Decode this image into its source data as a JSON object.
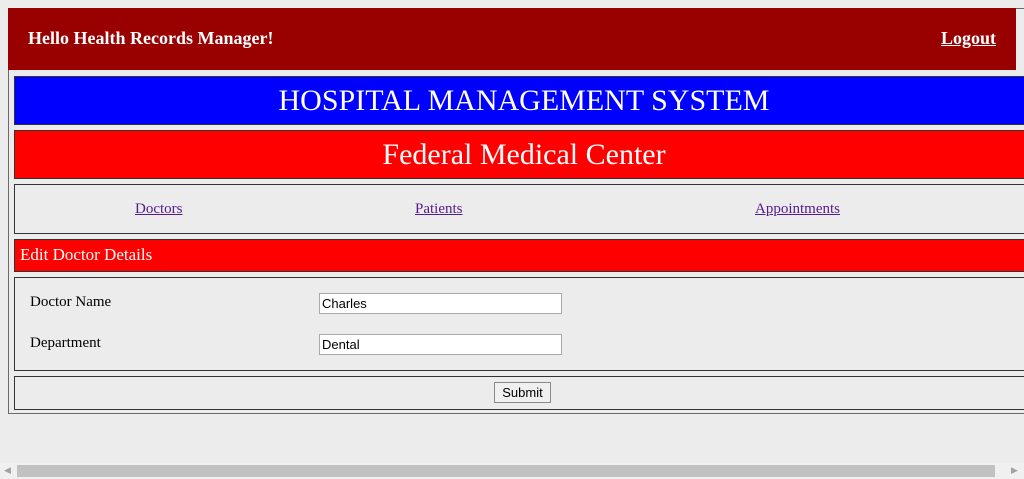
{
  "header": {
    "greeting": "Hello Health Records Manager!",
    "logout_label": "Logout"
  },
  "banner": {
    "system_title": "HOSPITAL MANAGEMENT SYSTEM",
    "center_name": "Federal Medical Center"
  },
  "nav": {
    "items": [
      {
        "label": "Doctors"
      },
      {
        "label": "Patients"
      },
      {
        "label": "Appointments"
      }
    ]
  },
  "form": {
    "title": "Edit Doctor Details",
    "fields": [
      {
        "label": "Doctor Name",
        "value": "Charles"
      },
      {
        "label": "Department",
        "value": "Dental"
      }
    ],
    "submit_label": "Submit"
  },
  "colors": {
    "header_bg": "#990000",
    "title_bg": "#0000ff",
    "center_bg": "#ff0000",
    "link": "#551a8b"
  },
  "scrollbar": {
    "left_arrow_icon": "triangle-left-icon",
    "right_arrow_icon": "triangle-right-icon"
  }
}
